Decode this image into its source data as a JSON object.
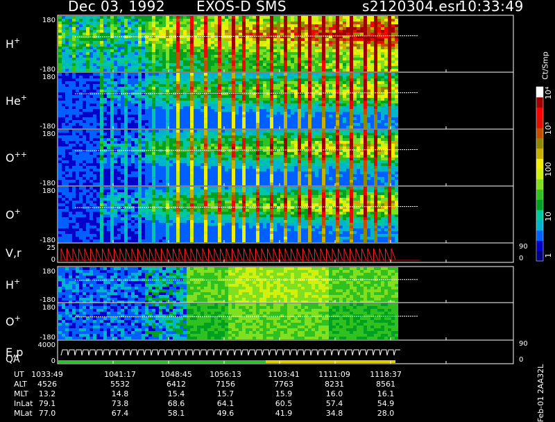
{
  "header": {
    "date": "Dec 03, 1992",
    "mission": "EXOS-D SMS",
    "file": "s2120304.esr",
    "time": "10:33:49"
  },
  "colorbar": {
    "unit": "Ct/Smp",
    "tick_labels": [
      "1",
      "10",
      "100",
      "10³",
      "10⁴"
    ],
    "colors": [
      "#000080",
      "#0000c8",
      "#0060ff",
      "#00b4d0",
      "#00c8a0",
      "#00a020",
      "#30c020",
      "#80e020",
      "#d0f010",
      "#f0f000",
      "#c8b000",
      "#908800",
      "#c05000",
      "#e01000",
      "#ff0000",
      "#a00000",
      "#ffffff"
    ]
  },
  "chart_data": {
    "type": "heatmap",
    "title": "Dec 03, 1992   EXOS-D SMS",
    "time_axis": {
      "start": "1033:49",
      "end": "1118:37"
    },
    "panels": [
      {
        "label": "H",
        "sup": "+",
        "ytop": "180",
        "ybot": "-180",
        "style": "spin"
      },
      {
        "label": "He",
        "sup": "+",
        "ytop": "180",
        "ybot": "-180",
        "style": "spin"
      },
      {
        "label": "O",
        "sup": "++",
        "ytop": "180",
        "ybot": "-180",
        "style": "spin"
      },
      {
        "label": "O",
        "sup": "+",
        "ytop": "180",
        "ybot": "-180",
        "style": "spin"
      },
      {
        "label": "V,r",
        "sup": "",
        "ytop": "25",
        "ybot": "0",
        "style": "line",
        "right_top": "90",
        "right_bot": "0"
      },
      {
        "label": "H",
        "sup": "+",
        "ytop": "180",
        "ybot": "-180",
        "style": "flow"
      },
      {
        "label": "O",
        "sup": "+",
        "ytop": "180",
        "ybot": "-180",
        "style": "flow"
      },
      {
        "label": "E,p",
        "sup": "",
        "label2": "QA",
        "ytop": "4000",
        "ybot": "0",
        "style": "sweep",
        "right_top": "90",
        "right_bot": "0"
      }
    ],
    "footer": {
      "rows": [
        {
          "label": "UT",
          "values": [
            "1033:49",
            "1041:17",
            "1048:45",
            "1056:13",
            "1103:41",
            "1111:09",
            "1118:37"
          ]
        },
        {
          "label": "ALT",
          "values": [
            "4526",
            "5532",
            "6412",
            "7156",
            "7763",
            "8231",
            "8561"
          ]
        },
        {
          "label": "MLT",
          "values": [
            "13.2",
            "14.8",
            "15.4",
            "15.7",
            "15.9",
            "16.0",
            "16.1"
          ]
        },
        {
          "label": "InLat",
          "values": [
            "79.1",
            "73.8",
            "68.6",
            "64.1",
            "60.5",
            "57.4",
            "54.9"
          ]
        },
        {
          "label": "MLat",
          "values": [
            "77.0",
            "67.4",
            "58.1",
            "49.6",
            "41.9",
            "34.8",
            "28.0"
          ]
        }
      ]
    },
    "file_id": "Feb-01 2AA32L"
  }
}
